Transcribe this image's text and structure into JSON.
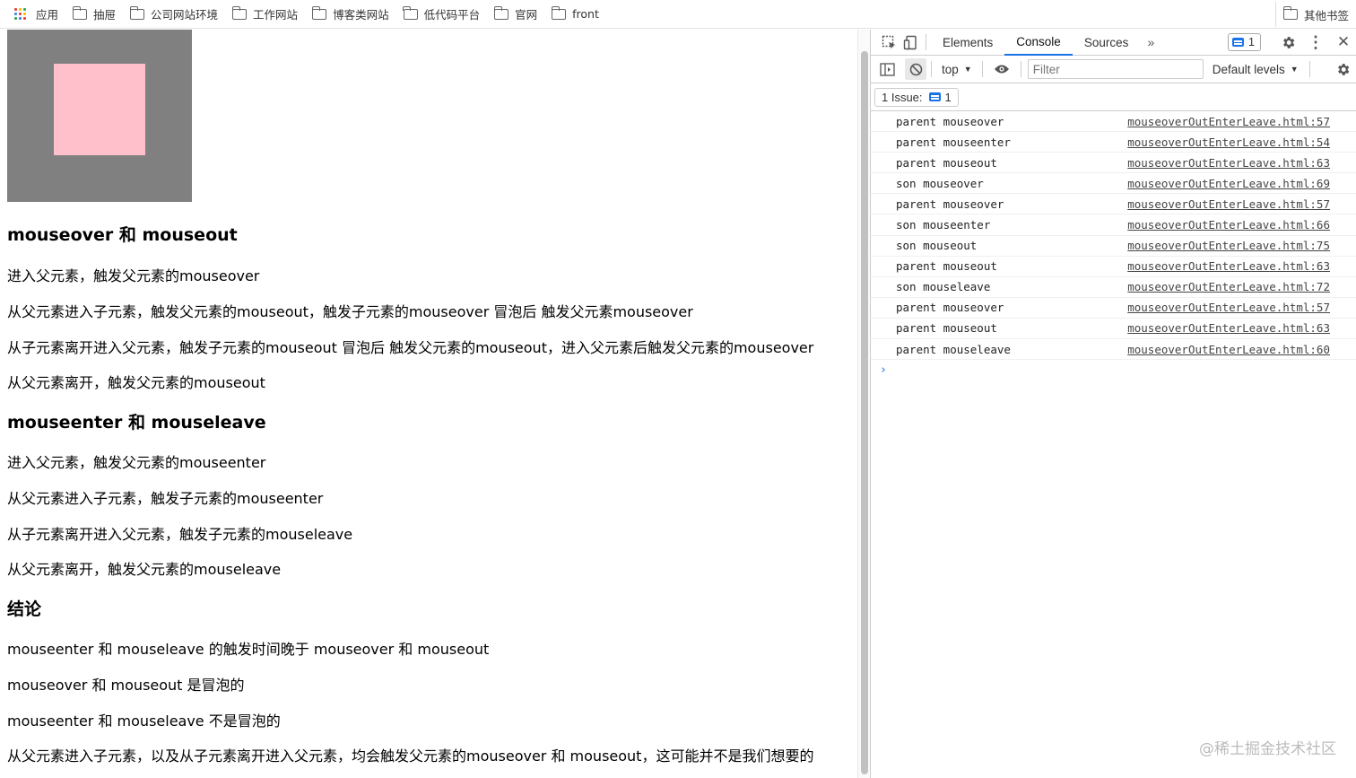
{
  "bookmarks": {
    "apps_label": "应用",
    "items": [
      "抽屉",
      "公司网站环境",
      "工作网站",
      "博客类网站",
      "低代码平台",
      "官网",
      "front"
    ],
    "other_label": "其他书签"
  },
  "page": {
    "colors": {
      "parent_box": "#808080",
      "son_box": "#ffc0cb"
    },
    "h_over_out": "mouseover 和 mouseout",
    "over_out": [
      "进入父元素，触发父元素的mouseover",
      "从父元素进入子元素，触发父元素的mouseout，触发子元素的mouseover 冒泡后 触发父元素mouseover",
      "从子元素离开进入父元素，触发子元素的mouseout 冒泡后 触发父元素的mouseout，进入父元素后触发父元素的mouseover",
      "从父元素离开，触发父元素的mouseout"
    ],
    "h_enter_leave": "mouseenter 和 mouseleave",
    "enter_leave": [
      "进入父元素，触发父元素的mouseenter",
      "从父元素进入子元素，触发子元素的mouseenter",
      "从子元素离开进入父元素，触发子元素的mouseleave",
      "从父元素离开，触发父元素的mouseleave"
    ],
    "h_conclusion": "结论",
    "conclusion": [
      "mouseenter 和 mouseleave 的触发时间晚于 mouseover 和 mouseout",
      "mouseover 和 mouseout 是冒泡的",
      "mouseenter 和 mouseleave 不是冒泡的",
      "从父元素进入子元素，以及从子元素离开进入父元素，均会触发父元素的mouseover 和 mouseout，这可能并不是我们想要的"
    ]
  },
  "devtools": {
    "tabs": [
      "Elements",
      "Console",
      "Sources"
    ],
    "active_tab": "Console",
    "issue_count": "1",
    "context": "top",
    "filter_placeholder": "Filter",
    "levels": "Default levels",
    "issues_label": "1 Issue:",
    "issues_count": "1",
    "accent": "#1a73e8",
    "logs": [
      {
        "msg": "parent mouseover",
        "src": "mouseoverOutEnterLeave.html:57"
      },
      {
        "msg": "parent mouseenter",
        "src": "mouseoverOutEnterLeave.html:54"
      },
      {
        "msg": "parent mouseout",
        "src": "mouseoverOutEnterLeave.html:63"
      },
      {
        "msg": "son mouseover",
        "src": "mouseoverOutEnterLeave.html:69"
      },
      {
        "msg": "parent mouseover",
        "src": "mouseoverOutEnterLeave.html:57"
      },
      {
        "msg": "son mouseenter",
        "src": "mouseoverOutEnterLeave.html:66"
      },
      {
        "msg": "son mouseout",
        "src": "mouseoverOutEnterLeave.html:75"
      },
      {
        "msg": "parent mouseout",
        "src": "mouseoverOutEnterLeave.html:63"
      },
      {
        "msg": "son mouseleave",
        "src": "mouseoverOutEnterLeave.html:72"
      },
      {
        "msg": "parent mouseover",
        "src": "mouseoverOutEnterLeave.html:57"
      },
      {
        "msg": "parent mouseout",
        "src": "mouseoverOutEnterLeave.html:63"
      },
      {
        "msg": "parent mouseleave",
        "src": "mouseoverOutEnterLeave.html:60"
      }
    ]
  },
  "watermark": "@稀土掘金技术社区"
}
